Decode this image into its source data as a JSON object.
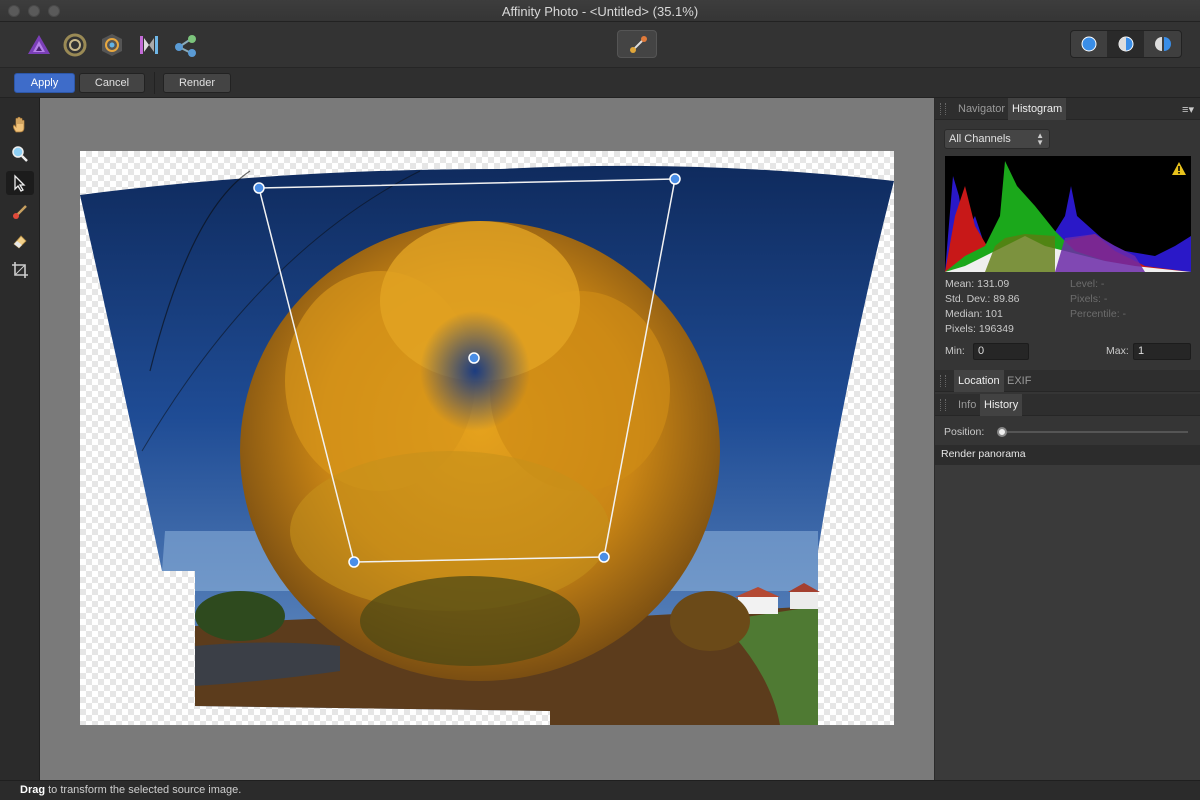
{
  "window": {
    "title": "Affinity Photo - <Untitled> (35.1%)"
  },
  "personas": [
    "photo-persona",
    "liquify-persona",
    "develop-persona",
    "tone-mapping-persona",
    "export-persona"
  ],
  "context_toolbar": {
    "apply": "Apply",
    "cancel": "Cancel",
    "render": "Render"
  },
  "tools": [
    "view-tool",
    "zoom-tool",
    "source-image-transform-tool",
    "source-image-brush",
    "source-image-eraser",
    "crop-tool"
  ],
  "panels": {
    "top_tabs": {
      "navigator": "Navigator",
      "histogram": "Histogram"
    },
    "channel_select": "All Channels",
    "histogram_stats": {
      "mean": "Mean: 131.09",
      "std_dev": "Std. Dev.: 89.86",
      "median": "Median: 101",
      "pixels": "Pixels: 196349",
      "level": "Level: -",
      "pixels_right": "Pixels: -",
      "percentile": "Percentile: -"
    },
    "min_label": "Min:",
    "min_value": "0",
    "max_label": "Max:",
    "max_value": "1",
    "location_tabs": {
      "location": "Location",
      "exif": "EXIF"
    },
    "info_tabs": {
      "info": "Info",
      "history": "History"
    },
    "position_label": "Position:",
    "history_item": "Render panorama"
  },
  "status": {
    "action": "Drag",
    "message": " to transform the selected source image."
  },
  "colors": {
    "accent": "#3e6cc9",
    "handle": "#4a8ee6",
    "canvas_bg": "#7a7a7a"
  }
}
